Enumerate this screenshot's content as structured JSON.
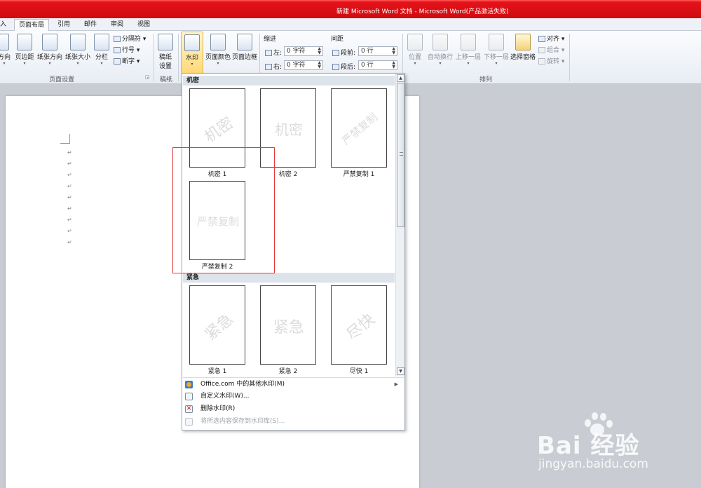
{
  "window": {
    "title": "新建 Microsoft Word 文档 - Microsoft Word(产品激活失败)"
  },
  "tabs": [
    {
      "label": "入"
    },
    {
      "label": "页面布局"
    },
    {
      "label": "引用"
    },
    {
      "label": "邮件"
    },
    {
      "label": "审阅"
    },
    {
      "label": "视图"
    }
  ],
  "ribbon": {
    "page_setup": {
      "buttons": [
        {
          "label": "方向"
        },
        {
          "label": "页边距"
        },
        {
          "label": "纸张方向"
        },
        {
          "label": "纸张大小"
        },
        {
          "label": "分栏"
        }
      ],
      "small": [
        {
          "label": "分隔符"
        },
        {
          "label": "行号"
        },
        {
          "label": "断字"
        }
      ],
      "group_label": "页面设置"
    },
    "manuscript": {
      "line1": "稿纸",
      "line2": "设置",
      "group_label": "稿纸"
    },
    "background": {
      "buttons": [
        {
          "label": "水印"
        },
        {
          "label": "页面颜色"
        },
        {
          "label": "页面边框"
        }
      ]
    },
    "paragraph": {
      "indent_label": "缩进",
      "spacing_label": "间距",
      "indent_left_label": "左:",
      "indent_left_value": "0 字符",
      "indent_right_label": "右:",
      "indent_right_value": "0 字符",
      "space_before_label": "段前:",
      "space_before_value": "0 行",
      "space_after_label": "段后:",
      "space_after_value": "0 行"
    },
    "arrange": {
      "buttons": [
        {
          "label": "位置"
        },
        {
          "label": "自动换行"
        },
        {
          "label": "上移一层"
        },
        {
          "label": "下移一层"
        },
        {
          "label": "选择窗格"
        }
      ],
      "small": [
        {
          "label": "对齐"
        },
        {
          "label": "组合"
        },
        {
          "label": "旋转"
        }
      ],
      "group_label": "排列"
    }
  },
  "watermark_gallery": {
    "sections": [
      {
        "header": "机密",
        "items": [
          {
            "text": "机密",
            "caption": "机密 1"
          },
          {
            "text": "机密",
            "caption": "机密 2"
          },
          {
            "text": "严禁复制",
            "caption": "严禁复制 1"
          },
          {
            "text": "严禁复制",
            "caption": "严禁复制 2"
          }
        ]
      },
      {
        "header": "紧急",
        "items": [
          {
            "text": "紧急",
            "caption": "紧急 1"
          },
          {
            "text": "紧急",
            "caption": "紧急 2"
          },
          {
            "text": "尽快",
            "caption": "尽快 1"
          }
        ]
      }
    ],
    "menu": [
      {
        "label": "Office.com 中的其他水印(M)"
      },
      {
        "label": "自定义水印(W)..."
      },
      {
        "label": "删除水印(R)"
      },
      {
        "label": "将所选内容保存到水印库(S)..."
      }
    ]
  },
  "document": {
    "paragraph_mark": "↵"
  },
  "site_watermark": {
    "brand": "Bai  经验",
    "url": "jingyan.baidu.com"
  }
}
